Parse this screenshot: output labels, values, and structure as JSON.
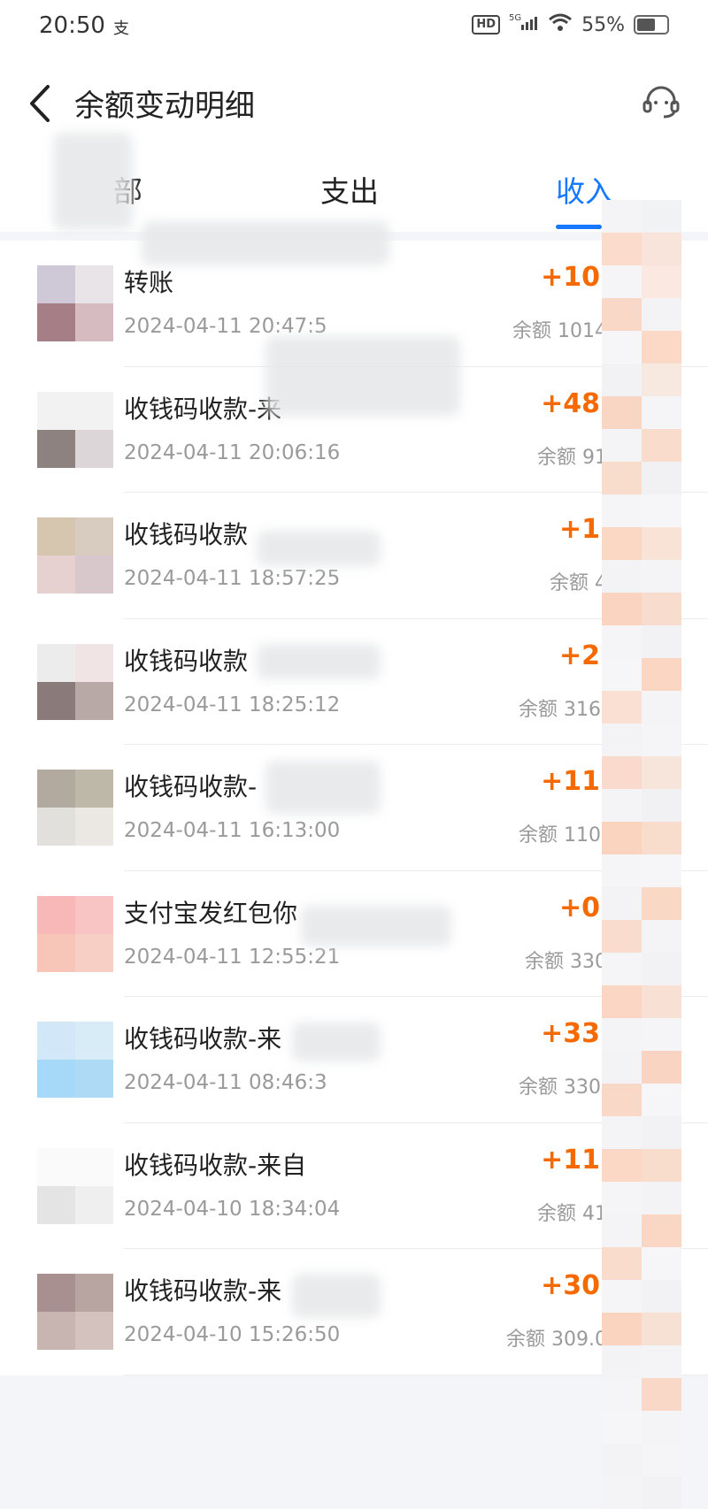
{
  "status_bar": {
    "time": "20:50",
    "carrier_icon": "支",
    "network": "5G",
    "hd": "HD",
    "battery": "55%"
  },
  "header": {
    "title": "余额变动明细",
    "back_icon": "chevron-left-icon",
    "support_icon": "headset-icon"
  },
  "tabs": [
    {
      "label": "部",
      "active": false
    },
    {
      "label": "支出",
      "active": false
    },
    {
      "label": "收入",
      "active": true
    }
  ],
  "colors": {
    "accent": "#1677ff",
    "amount": "#f56a00"
  },
  "transactions": [
    {
      "title": "转账",
      "time": "2024-04-11 20:47:5",
      "amount": "+10",
      "balance": "余额 1014"
    },
    {
      "title": "收钱码收款-来",
      "time": "2024-04-11 20:06:16",
      "amount": "+48",
      "balance": "余额 91"
    },
    {
      "title": "收钱码收款",
      "time": "2024-04-11 18:57:25",
      "amount": "+1",
      "balance": "余额 4"
    },
    {
      "title": "收钱码收款",
      "time": "2024-04-11 18:25:12",
      "amount": "+2",
      "balance": "余额 316."
    },
    {
      "title": "收钱码收款-",
      "time": "2024-04-11 16:13:00",
      "amount": "+11",
      "balance": "余额 110."
    },
    {
      "title": "支付宝发红包你",
      "time": "2024-04-11 12:55:21",
      "amount": "+0",
      "balance": "余额 330"
    },
    {
      "title": "收钱码收款-来",
      "time": "2024-04-11 08:46:3",
      "amount": "+33",
      "balance": "余额 330."
    },
    {
      "title": "收钱码收款-来自",
      "time": "2024-04-10 18:34:04",
      "amount": "+11",
      "balance": "余额 41"
    },
    {
      "title": "收钱码收款-来",
      "time": "2024-04-10 15:26:50",
      "amount": "+30",
      "balance": "余额 309.0"
    }
  ]
}
